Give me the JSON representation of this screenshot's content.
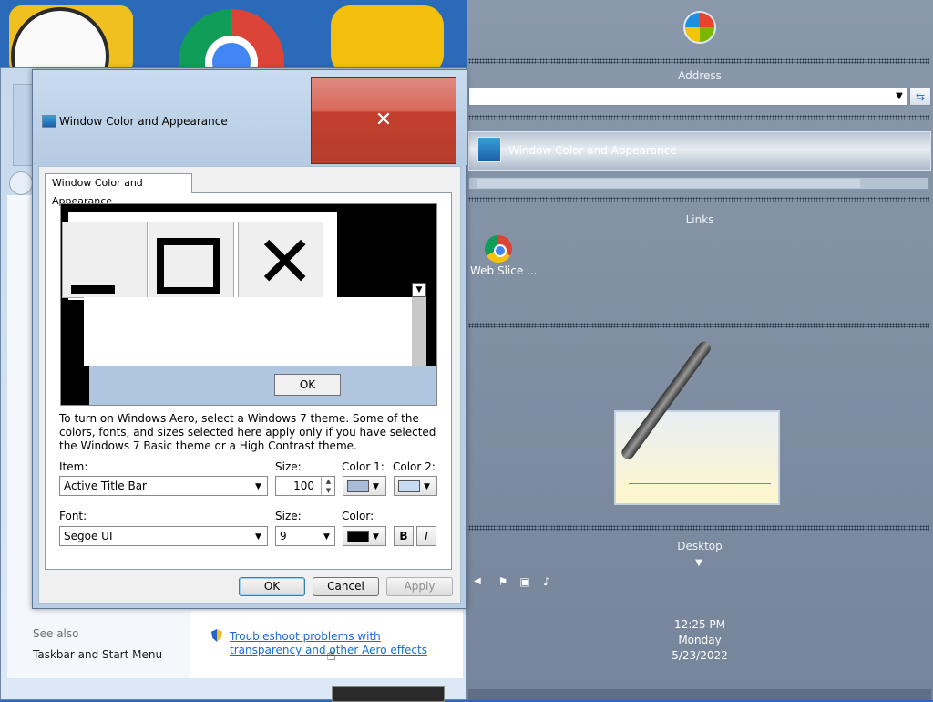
{
  "sidebar": {
    "address_label": "Address",
    "address_value": "",
    "address_go_icon": "refresh-arrows-icon",
    "task_tile_label": "Window Color and Appearance",
    "links_label": "Links",
    "link_item_label": "Web Slice ...",
    "desktop_label": "Desktop",
    "clock": {
      "time": "12:25 PM",
      "day": "Monday",
      "date": "5/23/2022"
    }
  },
  "background_window": {
    "see_also_label": "See also",
    "taskbar_link": "Taskbar and Start Menu",
    "aero_link": "Troubleshoot problems with transparency and other Aero effects"
  },
  "dialog": {
    "title": "Window Color and Appearance",
    "close_glyph": "✕",
    "tab_label": "Window Color and Appearance",
    "preview": {
      "ok_label": "OK",
      "close_glyph": "✕"
    },
    "description": "To turn on Windows Aero, select a Windows 7 theme.  Some of the colors, fonts, and sizes selected here apply only if you have selected the Windows 7 Basic theme or a High Contrast theme.",
    "item_label": "Item:",
    "item_value": "Active Title Bar",
    "item_size_label": "Size:",
    "item_size_value": "100",
    "color1_label": "Color 1:",
    "color2_label": "Color 2:",
    "font_label": "Font:",
    "font_value": "Segoe UI",
    "font_size_label": "Size:",
    "font_size_value": "9",
    "font_color_label": "Color:",
    "bold_label": "B",
    "italic_label": "I",
    "ok_label": "OK",
    "cancel_label": "Cancel",
    "apply_label": "Apply",
    "color1_value": "#a6bcd8",
    "color2_value": "#c6dcf2",
    "font_color_value": "#000000"
  }
}
